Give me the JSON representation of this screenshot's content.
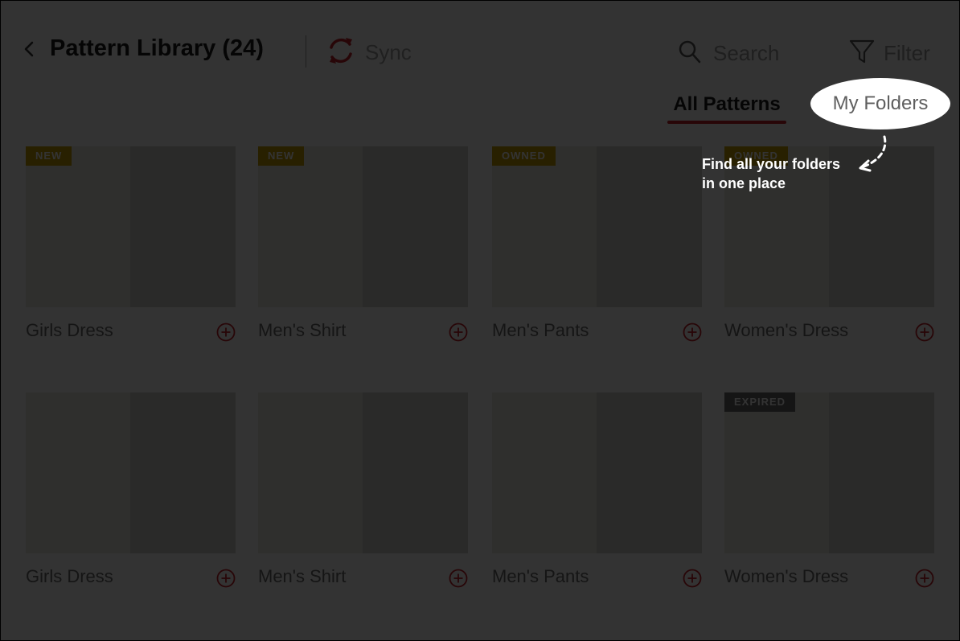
{
  "header": {
    "title": "Pattern Library (24)",
    "sync_label": "Sync",
    "search_label": "Search",
    "filter_label": "Filter"
  },
  "tabs": {
    "all_patterns": "All Patterns",
    "my_folders": "My Folders"
  },
  "patterns": [
    {
      "name": "Girls Dress",
      "badge": "NEW"
    },
    {
      "name": "Men's Shirt",
      "badge": "NEW"
    },
    {
      "name": "Men's Pants",
      "badge": "OWNED"
    },
    {
      "name": "Women's Dress",
      "badge": "OWNED"
    },
    {
      "name": "Girls Dress",
      "badge": ""
    },
    {
      "name": "Men's Shirt",
      "badge": ""
    },
    {
      "name": "Men's Pants",
      "badge": ""
    },
    {
      "name": "Women's Dress",
      "badge": "EXPIRED"
    }
  ],
  "coachmark": {
    "line1": "Find all your folders",
    "line2": "in one place"
  },
  "colors": {
    "accent": "#c5222a",
    "badge_new": "#c9a000",
    "badge_expired": "#6b6b6b",
    "overlay": "rgba(0,0,0,0.8)"
  }
}
